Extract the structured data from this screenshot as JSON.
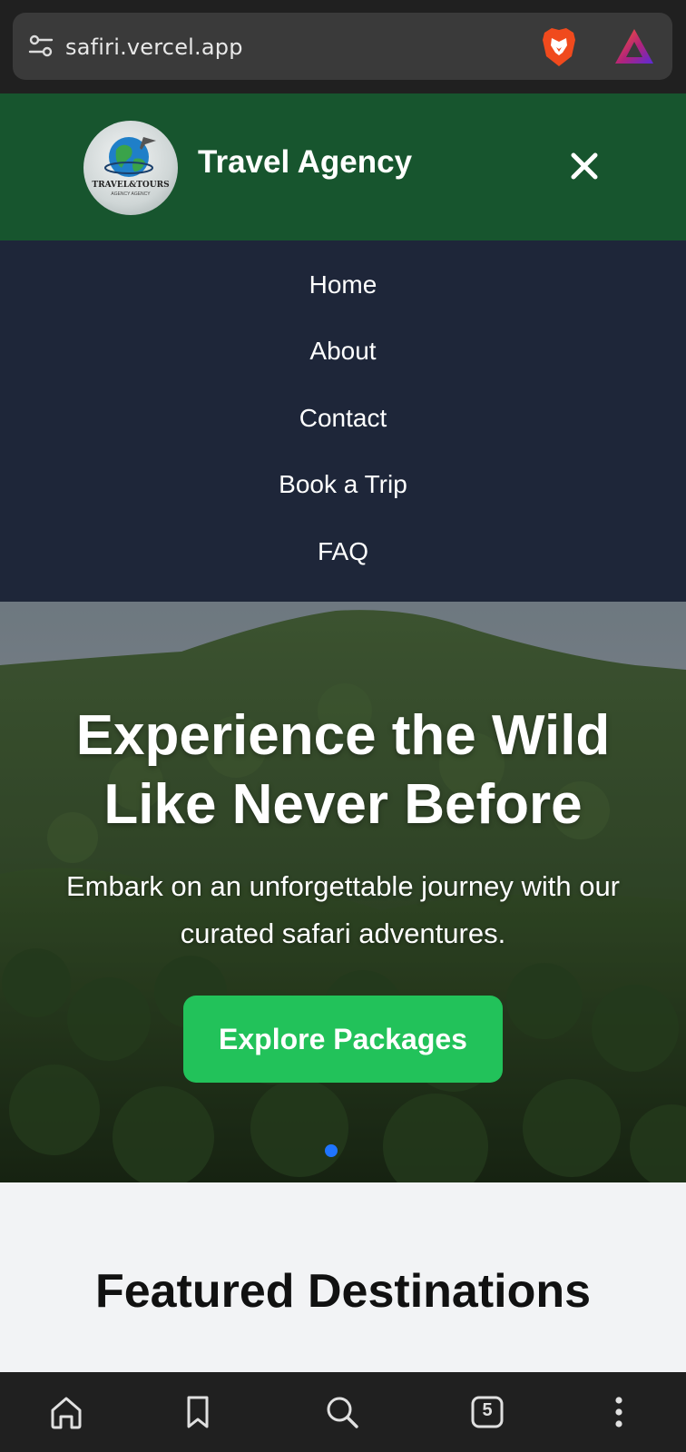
{
  "browser": {
    "url": "safiri.vercel.app",
    "tab_count": "5",
    "icons": {
      "site_info": "site-settings-icon",
      "brave": "brave-lion-icon",
      "rewards": "brave-rewards-icon"
    },
    "bottom_nav": [
      "home-icon",
      "bookmark-icon",
      "search-icon",
      "tabs-icon",
      "more-menu-icon"
    ]
  },
  "header": {
    "logo_text": "TRAVEL&TOURS",
    "logo_sub": "AGENCY AGENCY",
    "title": "Travel Agency",
    "close_icon": "close-icon",
    "brand_color": "#17552e"
  },
  "nav": {
    "items": [
      {
        "label": "Home"
      },
      {
        "label": "About"
      },
      {
        "label": "Contact"
      },
      {
        "label": "Book a Trip"
      },
      {
        "label": "FAQ"
      }
    ],
    "background": "#1e2639"
  },
  "hero": {
    "title": "Experience the Wild Like Never Before",
    "subtitle": "Embark on an unforgettable journey with our curated safari adventures.",
    "cta_label": "Explore Packages",
    "cta_color": "#22c25a",
    "active_slide_color": "#1f75ff"
  },
  "featured": {
    "title": "Featured Destinations"
  }
}
